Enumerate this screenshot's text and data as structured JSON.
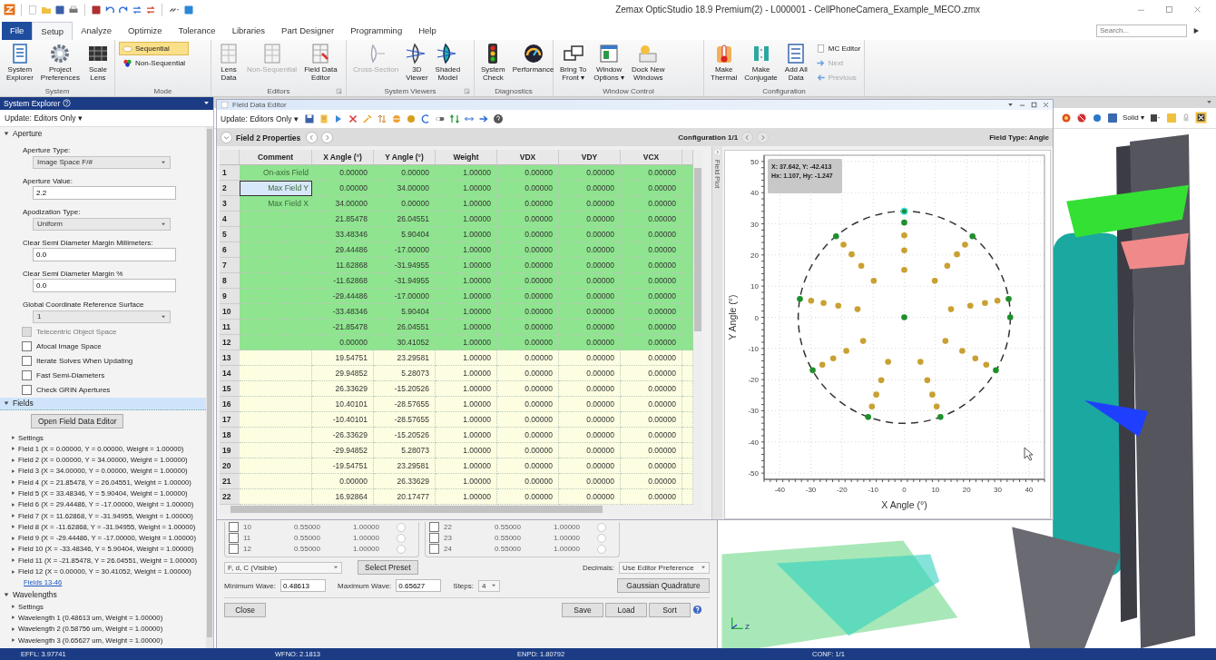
{
  "window": {
    "title": "Zemax OpticStudio 18.9   Premium(2) - L000001 - CellPhoneCamera_Example_MECO.zmx"
  },
  "search": {
    "placeholder": "Search..."
  },
  "ribbon_tabs": [
    {
      "label": "File",
      "kind": "file",
      "selected": false
    },
    {
      "label": "Setup",
      "kind": "tab",
      "selected": true
    },
    {
      "label": "Analyze",
      "kind": "tab",
      "selected": false
    },
    {
      "label": "Optimize",
      "kind": "tab",
      "selected": false
    },
    {
      "label": "Tolerance",
      "kind": "tab",
      "selected": false
    },
    {
      "label": "Libraries",
      "kind": "tab",
      "selected": false
    },
    {
      "label": "Part Designer",
      "kind": "tab",
      "selected": false
    },
    {
      "label": "Programming",
      "kind": "tab",
      "selected": false
    },
    {
      "label": "Help",
      "kind": "tab",
      "selected": false
    }
  ],
  "ribbon_groups": [
    {
      "label": "System",
      "launcher": false,
      "buttons": [
        {
          "kind": "large",
          "label": "System\nExplorer",
          "disabled": false
        },
        {
          "kind": "large",
          "label": "Project\nPreferences",
          "disabled": false
        },
        {
          "kind": "large",
          "label": "Scale\nLens",
          "disabled": false
        }
      ]
    },
    {
      "label": "Mode",
      "launcher": false,
      "buttons": [
        {
          "kind": "toggle",
          "label": "Sequential",
          "selected": true
        },
        {
          "kind": "toggle",
          "label": "Non-Sequential",
          "selected": false
        }
      ]
    },
    {
      "label": "Editors",
      "launcher": true,
      "buttons": [
        {
          "kind": "large",
          "label": "Lens\nData",
          "disabled": false
        },
        {
          "kind": "large",
          "label": "Non-Sequential",
          "disabled": true
        },
        {
          "kind": "large",
          "label": "Field Data\nEditor",
          "disabled": false
        }
      ]
    },
    {
      "label": "System Viewers",
      "launcher": true,
      "buttons": [
        {
          "kind": "large",
          "label": "Cross-Section",
          "disabled": true
        },
        {
          "kind": "large",
          "label": "3D\nViewer",
          "disabled": false
        },
        {
          "kind": "large",
          "label": "Shaded\nModel",
          "disabled": false
        }
      ]
    },
    {
      "label": "Diagnostics",
      "launcher": false,
      "buttons": [
        {
          "kind": "large",
          "label": "System\nCheck",
          "disabled": false
        },
        {
          "kind": "large",
          "label": "Performance",
          "disabled": false
        }
      ]
    },
    {
      "label": "Window Control",
      "launcher": false,
      "buttons": [
        {
          "kind": "large",
          "label": "Bring To\nFront ▾",
          "disabled": false
        },
        {
          "kind": "large",
          "label": "Window\nOptions ▾",
          "disabled": false
        },
        {
          "kind": "large",
          "label": "Dock New\nWindows",
          "disabled": false
        }
      ]
    },
    {
      "label": "Configuration",
      "launcher": false,
      "buttons": [
        {
          "kind": "large",
          "label": "Make\nThermal",
          "disabled": false
        },
        {
          "kind": "large",
          "label": "Make\nConjugate",
          "disabled": false
        },
        {
          "kind": "large",
          "label": "Add All\nData",
          "disabled": false
        },
        {
          "kind": "small",
          "label": "MC Editor",
          "disabled": false
        },
        {
          "kind": "small",
          "label": "Next",
          "disabled": true
        },
        {
          "kind": "small",
          "label": "Previous",
          "disabled": true
        }
      ]
    }
  ],
  "system_explorer": {
    "title": "System Explorer",
    "update": "Update: Editors Only ▾",
    "sections": [
      {
        "label": "Aperture",
        "expanded": true,
        "selected": false,
        "rows": [
          {
            "kind": "label",
            "text": "Aperture Type:"
          },
          {
            "kind": "dropdown",
            "text": "Image Space F/#"
          },
          {
            "kind": "label",
            "text": "Aperture Value:"
          },
          {
            "kind": "input",
            "text": "2.2"
          },
          {
            "kind": "label",
            "text": "Apodization Type:"
          },
          {
            "kind": "dropdown",
            "text": "Uniform"
          },
          {
            "kind": "label",
            "text": "Clear Semi Diameter Margin Millimeters:"
          },
          {
            "kind": "input",
            "text": "0.0"
          },
          {
            "kind": "label",
            "text": "Clear Semi Diameter Margin %"
          },
          {
            "kind": "input",
            "text": "0.0"
          },
          {
            "kind": "label",
            "text": "Global Coordinate Reference Surface"
          },
          {
            "kind": "dropdown",
            "text": "1"
          },
          {
            "kind": "checkbox",
            "text": "Telecentric Object Space",
            "checked": false,
            "disabled": true
          },
          {
            "kind": "checkbox",
            "text": "Afocal Image Space",
            "checked": false,
            "disabled": false
          },
          {
            "kind": "checkbox",
            "text": "Iterate Solves When Updating",
            "checked": false,
            "disabled": false
          },
          {
            "kind": "checkbox",
            "text": "Fast Semi-Diameters",
            "checked": false,
            "disabled": false
          },
          {
            "kind": "checkbox",
            "text": "Check GRIN Apertures",
            "checked": false,
            "disabled": false
          }
        ]
      },
      {
        "label": "Fields",
        "expanded": true,
        "selected": true,
        "rows": [
          {
            "kind": "button",
            "text": "Open Field Data Editor"
          },
          {
            "kind": "tree",
            "text": "Settings"
          },
          {
            "kind": "tree",
            "text": "Field 1 (X = 0.00000, Y = 0.00000, Weight = 1.00000)"
          },
          {
            "kind": "tree",
            "text": "Field 2 (X = 0.00000, Y = 34.00000, Weight = 1.00000)"
          },
          {
            "kind": "tree",
            "text": "Field 3 (X = 34.00000, Y = 0.00000, Weight = 1.00000)"
          },
          {
            "kind": "tree",
            "text": "Field 4 (X = 21.85478, Y = 26.04551, Weight = 1.00000)"
          },
          {
            "kind": "tree",
            "text": "Field 5 (X = 33.48346, Y = 5.90404, Weight = 1.00000)"
          },
          {
            "kind": "tree",
            "text": "Field 6 (X = 29.44486, Y = -17.00000, Weight = 1.00000)"
          },
          {
            "kind": "tree",
            "text": "Field 7 (X = 11.62868, Y = -31.94955, Weight = 1.00000)"
          },
          {
            "kind": "tree",
            "text": "Field 8 (X = -11.62868, Y = -31.94955, Weight = 1.00000)"
          },
          {
            "kind": "tree",
            "text": "Field 9 (X = -29.44486, Y = -17.00000, Weight = 1.00000)"
          },
          {
            "kind": "tree",
            "text": "Field 10 (X = -33.48346, Y = 5.90404, Weight = 1.00000)"
          },
          {
            "kind": "tree",
            "text": "Field 11 (X = -21.85478, Y = 26.04551, Weight = 1.00000)"
          },
          {
            "kind": "tree",
            "text": "Field 12 (X = 0.00000, Y = 30.41052, Weight = 1.00000)"
          },
          {
            "kind": "link",
            "text": "Fields 13-46"
          }
        ]
      },
      {
        "label": "Wavelengths",
        "expanded": true,
        "selected": false,
        "rows": [
          {
            "kind": "tree",
            "text": "Settings"
          },
          {
            "kind": "tree",
            "text": "Wavelength 1 (0.48613 um, Weight = 1.00000)"
          },
          {
            "kind": "tree",
            "text": "Wavelength 2 (0.58756 um, Weight = 1.00000)"
          },
          {
            "kind": "tree",
            "text": "Wavelength 3 (0.65627 um, Weight = 1.00000)"
          }
        ]
      }
    ]
  },
  "editor": {
    "title": "Field Data Editor",
    "update": "Update: Editors Only ▾",
    "properties": "Field  2 Properties",
    "configuration": "Configuration 1/1",
    "field_type": "Field Type: Angle",
    "plot_tab": "Field Plot",
    "table": {
      "columns": [
        "Comment",
        "X Angle (°)",
        "Y Angle (°)",
        "Weight",
        "VDX",
        "VDY",
        "VCX"
      ],
      "rows": [
        {
          "number": "1",
          "color": "#8fe48f",
          "selected": false,
          "cells": [
            "On-axis Field",
            "0.00000",
            "0.00000",
            "1.00000",
            "0.00000",
            "0.00000",
            "0.00000"
          ]
        },
        {
          "number": "2",
          "color": "#8fe48f",
          "selected": true,
          "cells": [
            "Max Field Y",
            "0.00000",
            "34.00000",
            "1.00000",
            "0.00000",
            "0.00000",
            "0.00000"
          ]
        },
        {
          "number": "3",
          "color": "#8fe48f",
          "selected": false,
          "cells": [
            "Max Field X",
            "34.00000",
            "0.00000",
            "1.00000",
            "0.00000",
            "0.00000",
            "0.00000"
          ]
        },
        {
          "number": "4",
          "color": "#8fe48f",
          "selected": false,
          "cells": [
            "",
            "21.85478",
            "26.04551",
            "1.00000",
            "0.00000",
            "0.00000",
            "0.00000"
          ]
        },
        {
          "number": "5",
          "color": "#8fe48f",
          "selected": false,
          "cells": [
            "",
            "33.48346",
            "5.90404",
            "1.00000",
            "0.00000",
            "0.00000",
            "0.00000"
          ]
        },
        {
          "number": "6",
          "color": "#8fe48f",
          "selected": false,
          "cells": [
            "",
            "29.44486",
            "-17.00000",
            "1.00000",
            "0.00000",
            "0.00000",
            "0.00000"
          ]
        },
        {
          "number": "7",
          "color": "#8fe48f",
          "selected": false,
          "cells": [
            "",
            "11.62868",
            "-31.94955",
            "1.00000",
            "0.00000",
            "0.00000",
            "0.00000"
          ]
        },
        {
          "number": "8",
          "color": "#8fe48f",
          "selected": false,
          "cells": [
            "",
            "-11.62868",
            "-31.94955",
            "1.00000",
            "0.00000",
            "0.00000",
            "0.00000"
          ]
        },
        {
          "number": "9",
          "color": "#8fe48f",
          "selected": false,
          "cells": [
            "",
            "-29.44486",
            "-17.00000",
            "1.00000",
            "0.00000",
            "0.00000",
            "0.00000"
          ]
        },
        {
          "number": "10",
          "color": "#8fe48f",
          "selected": false,
          "cells": [
            "",
            "-33.48346",
            "5.90404",
            "1.00000",
            "0.00000",
            "0.00000",
            "0.00000"
          ]
        },
        {
          "number": "11",
          "color": "#8fe48f",
          "selected": false,
          "cells": [
            "",
            "-21.85478",
            "26.04551",
            "1.00000",
            "0.00000",
            "0.00000",
            "0.00000"
          ]
        },
        {
          "number": "12",
          "color": "#8fe48f",
          "selected": false,
          "cells": [
            "",
            "0.00000",
            "30.41052",
            "1.00000",
            "0.00000",
            "0.00000",
            "0.00000"
          ]
        },
        {
          "number": "13",
          "color": "#fdfde2",
          "selected": false,
          "cells": [
            "",
            "19.54751",
            "23.29581",
            "1.00000",
            "0.00000",
            "0.00000",
            "0.00000"
          ]
        },
        {
          "number": "14",
          "color": "#fdfde2",
          "selected": false,
          "cells": [
            "",
            "29.94852",
            "5.28073",
            "1.00000",
            "0.00000",
            "0.00000",
            "0.00000"
          ]
        },
        {
          "number": "15",
          "color": "#fdfde2",
          "selected": false,
          "cells": [
            "",
            "26.33629",
            "-15.20526",
            "1.00000",
            "0.00000",
            "0.00000",
            "0.00000"
          ]
        },
        {
          "number": "16",
          "color": "#fdfde2",
          "selected": false,
          "cells": [
            "",
            "10.40101",
            "-28.57655",
            "1.00000",
            "0.00000",
            "0.00000",
            "0.00000"
          ]
        },
        {
          "number": "17",
          "color": "#fdfde2",
          "selected": false,
          "cells": [
            "",
            "-10.40101",
            "-28.57655",
            "1.00000",
            "0.00000",
            "0.00000",
            "0.00000"
          ]
        },
        {
          "number": "18",
          "color": "#fdfde2",
          "selected": false,
          "cells": [
            "",
            "-26.33629",
            "-15.20526",
            "1.00000",
            "0.00000",
            "0.00000",
            "0.00000"
          ]
        },
        {
          "number": "19",
          "color": "#fdfde2",
          "selected": false,
          "cells": [
            "",
            "-29.94852",
            "5.28073",
            "1.00000",
            "0.00000",
            "0.00000",
            "0.00000"
          ]
        },
        {
          "number": "20",
          "color": "#fdfde2",
          "selected": false,
          "cells": [
            "",
            "-19.54751",
            "23.29581",
            "1.00000",
            "0.00000",
            "0.00000",
            "0.00000"
          ]
        },
        {
          "number": "21",
          "color": "#fdfde2",
          "selected": false,
          "cells": [
            "",
            "0.00000",
            "26.33629",
            "1.00000",
            "0.00000",
            "0.00000",
            "0.00000"
          ]
        },
        {
          "number": "22",
          "color": "#fdfde2",
          "selected": false,
          "cells": [
            "",
            "16.92864",
            "20.17477",
            "1.00000",
            "0.00000",
            "0.00000",
            "0.00000"
          ]
        }
      ]
    },
    "chart_data": {
      "type": "scatter",
      "xlabel": "X Angle (°)",
      "ylabel": "Y Angle (°)",
      "xlim": [
        -45,
        45
      ],
      "ylim": [
        -52,
        52
      ],
      "xticks": [
        -40,
        -30,
        -20,
        -10,
        0,
        10,
        20,
        30,
        40
      ],
      "yticks": [
        -50,
        -40,
        -30,
        -20,
        -10,
        0,
        10,
        20,
        30,
        40,
        50
      ],
      "series": [
        {
          "color": "#1f8f2c",
          "x": [
            0,
            0,
            34,
            21.9,
            33.5,
            29.4,
            11.6,
            -11.6,
            -29.4,
            -33.5,
            -21.9,
            0
          ],
          "values": [
            0,
            34,
            0,
            26,
            5.9,
            -17,
            -32,
            -32,
            -17,
            5.9,
            26,
            30.4
          ]
        },
        {
          "color": "#c9a032",
          "x": [
            19.5,
            29.9,
            26.3,
            10.4,
            -10.4,
            -26.3,
            -29.9,
            -19.5,
            0,
            16.9,
            25.9,
            22.8,
            9,
            -9,
            -22.8,
            -25.9,
            -16.9,
            0,
            13.8,
            21.2,
            18.6,
            7.4,
            -7.4,
            -18.6,
            -21.2,
            -13.8,
            0,
            9.8,
            15,
            13.2,
            5.2,
            -5.2,
            -13.2,
            -15,
            -9.8
          ],
          "values": [
            23.3,
            5.3,
            -15.2,
            -28.6,
            -28.6,
            -15.2,
            5.3,
            23.3,
            26.3,
            20.2,
            4.6,
            -13.2,
            -24.8,
            -24.8,
            -13.2,
            4.6,
            20.2,
            21.5,
            16.5,
            3.7,
            -10.8,
            -20.2,
            -20.2,
            -10.8,
            3.7,
            16.5,
            15.2,
            11.7,
            2.6,
            -7.6,
            -14.3,
            -14.3,
            -7.6,
            2.6,
            11.7
          ]
        }
      ],
      "grid": true,
      "annotations": [
        {
          "text": "X: 37.642,  Y: -42.413"
        },
        {
          "text": "Hx: 1.107, Hy: -1.247"
        }
      ]
    }
  },
  "wavelength_panel": {
    "rows": [
      [
        {
          "number": "10",
          "value": "0.55000",
          "weight": "1.00000",
          "checked": false,
          "selected": false
        },
        {
          "number": "22",
          "value": "0.55000",
          "weight": "1.00000",
          "checked": false,
          "selected": false
        }
      ],
      [
        {
          "number": "11",
          "value": "0.55000",
          "weight": "1.00000",
          "checked": false,
          "selected": false
        },
        {
          "number": "23",
          "value": "0.55000",
          "weight": "1.00000",
          "checked": false,
          "selected": false
        }
      ],
      [
        {
          "number": "12",
          "value": "0.55000",
          "weight": "1.00000",
          "checked": false,
          "selected": false
        },
        {
          "number": "24",
          "value": "0.55000",
          "weight": "1.00000",
          "checked": false,
          "selected": false
        }
      ]
    ],
    "preset": "F, d, C (Visible)",
    "select_preset": "Select Preset",
    "decimals_label": "Decimals:",
    "decimals": "Use Editor Preference",
    "min_label": "Minimum Wave:",
    "min_value": "0.48613",
    "max_label": "Maximum Wave:",
    "max_value": "0.65627",
    "steps_label": "Steps:",
    "steps": "4",
    "gaussian": "Gaussian Quadrature",
    "close": "Close",
    "buttons": [
      "Save",
      "Load",
      "Sort"
    ]
  },
  "viewer": {
    "view_mode": "Solid ▾",
    "axis_label": "Z"
  },
  "status_bar": [
    "EFFL: 3.97741",
    "WFNO: 2.1813",
    "ENPD: 1.80792",
    "CONF: 1/1"
  ]
}
